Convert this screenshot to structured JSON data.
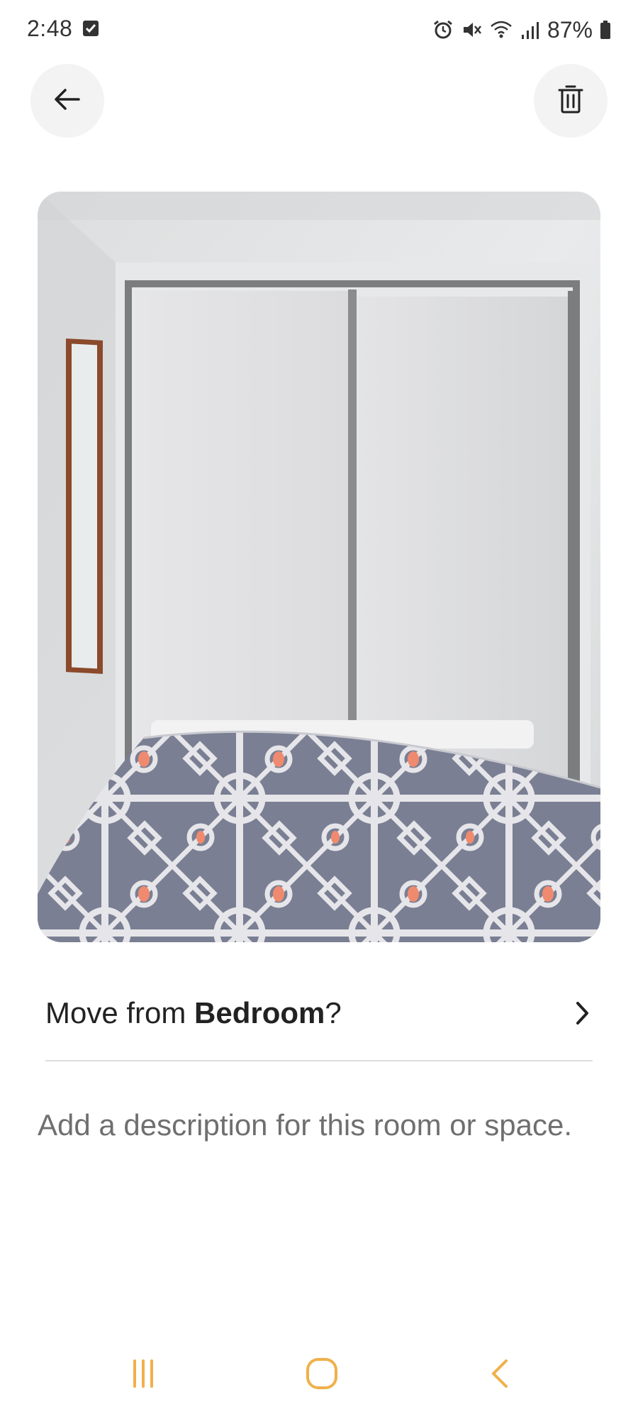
{
  "status_bar": {
    "time": "2:48",
    "battery": "87%",
    "icons": [
      "checkbox-icon",
      "alarm-icon",
      "mute-icon",
      "wifi-icon",
      "signal-icon",
      "battery-icon"
    ]
  },
  "header": {
    "back_icon": "arrow-left-icon",
    "delete_icon": "trash-icon"
  },
  "photo": {
    "subject": "bedroom-photo",
    "accent_colors": {
      "wall": "#e4e5e6",
      "bedspread": "#7a7f93",
      "pattern": "#e8e8ea",
      "coral": "#f08a6e",
      "mirror_frame": "#8b4a2b"
    }
  },
  "move_row": {
    "prefix": "Move from ",
    "room": "Bedroom",
    "suffix": "?"
  },
  "description": {
    "placeholder": "Add a description for this room or space."
  },
  "nav_bar": {
    "color": "#f0b04a",
    "icons": [
      "recents-icon",
      "home-icon",
      "back-chevron-icon"
    ]
  }
}
